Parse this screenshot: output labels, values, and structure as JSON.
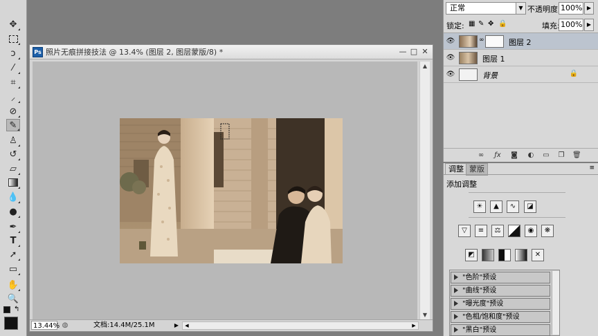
{
  "document": {
    "title": "照片无痕拼接技法 @ 13.4% (图层 2, 图层蒙版/8) *",
    "app_icon": "Ps",
    "zoom": "13.44%",
    "doc_size": "文档:14.4M/25.1M"
  },
  "layers_panel": {
    "blend_mode": "正常",
    "opacity_label": "不透明度:",
    "opacity": "100%",
    "lock_label": "锁定:",
    "fill_label": "填充:",
    "fill": "100%",
    "layers": [
      {
        "name": "图层 2",
        "selected": true,
        "has_mask": true
      },
      {
        "name": "图层 1",
        "selected": false,
        "has_mask": false
      },
      {
        "name": "背景",
        "selected": false,
        "has_mask": false,
        "locked": true
      }
    ]
  },
  "adjustments_panel": {
    "tabs": [
      "调整",
      "蒙版"
    ],
    "heading": "添加调整",
    "presets": [
      "\"色阶\"预设",
      "\"曲线\"预设",
      "\"曝光度\"预设",
      "\"色相/饱和度\"预设",
      "\"黑白\"预设"
    ]
  },
  "colors": {
    "foreground": "#111111",
    "background": "#ffffff"
  }
}
